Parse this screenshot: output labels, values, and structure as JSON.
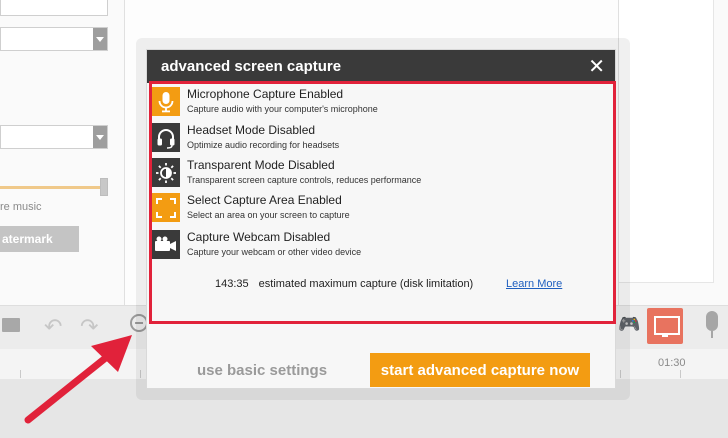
{
  "background": {
    "music_label": "re music",
    "watermark_button": "atermark",
    "timeline_time": "01:30"
  },
  "modal": {
    "title": "advanced screen capture",
    "close_glyph": "✕",
    "options": [
      {
        "title": "Microphone Capture Enabled",
        "description": "Capture audio with your computer's microphone",
        "icon": "microphone-icon",
        "enabled": true
      },
      {
        "title": "Headset Mode Disabled",
        "description": "Optimize audio recording for headsets",
        "icon": "headset-icon",
        "enabled": false
      },
      {
        "title": "Transparent Mode Disabled",
        "description": "Transparent screen capture controls, reduces performance",
        "icon": "brightness-icon",
        "enabled": false
      },
      {
        "title": "Select Capture Area Enabled",
        "description": "Select an area on your screen to capture",
        "icon": "capture-area-icon",
        "enabled": true
      },
      {
        "title": "Capture Webcam Disabled",
        "description": "Capture your webcam or other video device",
        "icon": "webcam-icon",
        "enabled": false
      }
    ],
    "estimate": {
      "time": "143:35",
      "text": "estimated maximum capture (disk limitation)",
      "link": "Learn More"
    },
    "buttons": {
      "basic": "use basic settings",
      "advanced": "start advanced capture now"
    }
  },
  "colors": {
    "accent": "#f39c12",
    "header": "#3a3a3a",
    "highlight": "#e1223a",
    "link": "#1f5fbf"
  }
}
